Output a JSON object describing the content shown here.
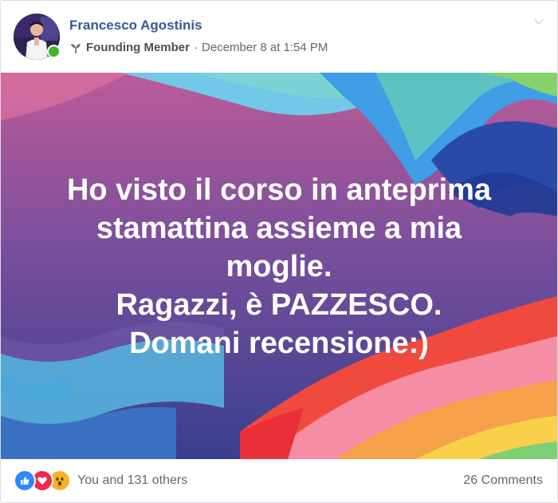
{
  "post": {
    "author": {
      "name": "Francesco Agostinis",
      "online": true,
      "avatar_icon": "speaker-on-stage-photo"
    },
    "badge": {
      "icon": "sprout-icon",
      "label": "Founding Member"
    },
    "separator": "·",
    "timestamp": "December 8 at 1:54 PM",
    "options_icon": "chevron-down-icon",
    "text_lines": [
      "Ho visto il corso in anteprima",
      "stamattina assieme a mia",
      "moglie.",
      "Ragazzi, è PAZZESCO.",
      "Domani recensione:)"
    ],
    "background": {
      "style": "rainbow-pride-gradient",
      "top_color": "#b75a97",
      "bottom_color": "#3a3f8f"
    },
    "reactions": {
      "icons": [
        "like-icon",
        "love-icon",
        "wow-icon"
      ],
      "summary": "You and 131 others"
    },
    "comments": "26 Comments"
  },
  "colors": {
    "link": "#385898",
    "meta": "#616770",
    "online": "#42b72a",
    "like": "#2d88ff",
    "love": "#f02849",
    "wow": "#f7b125"
  }
}
